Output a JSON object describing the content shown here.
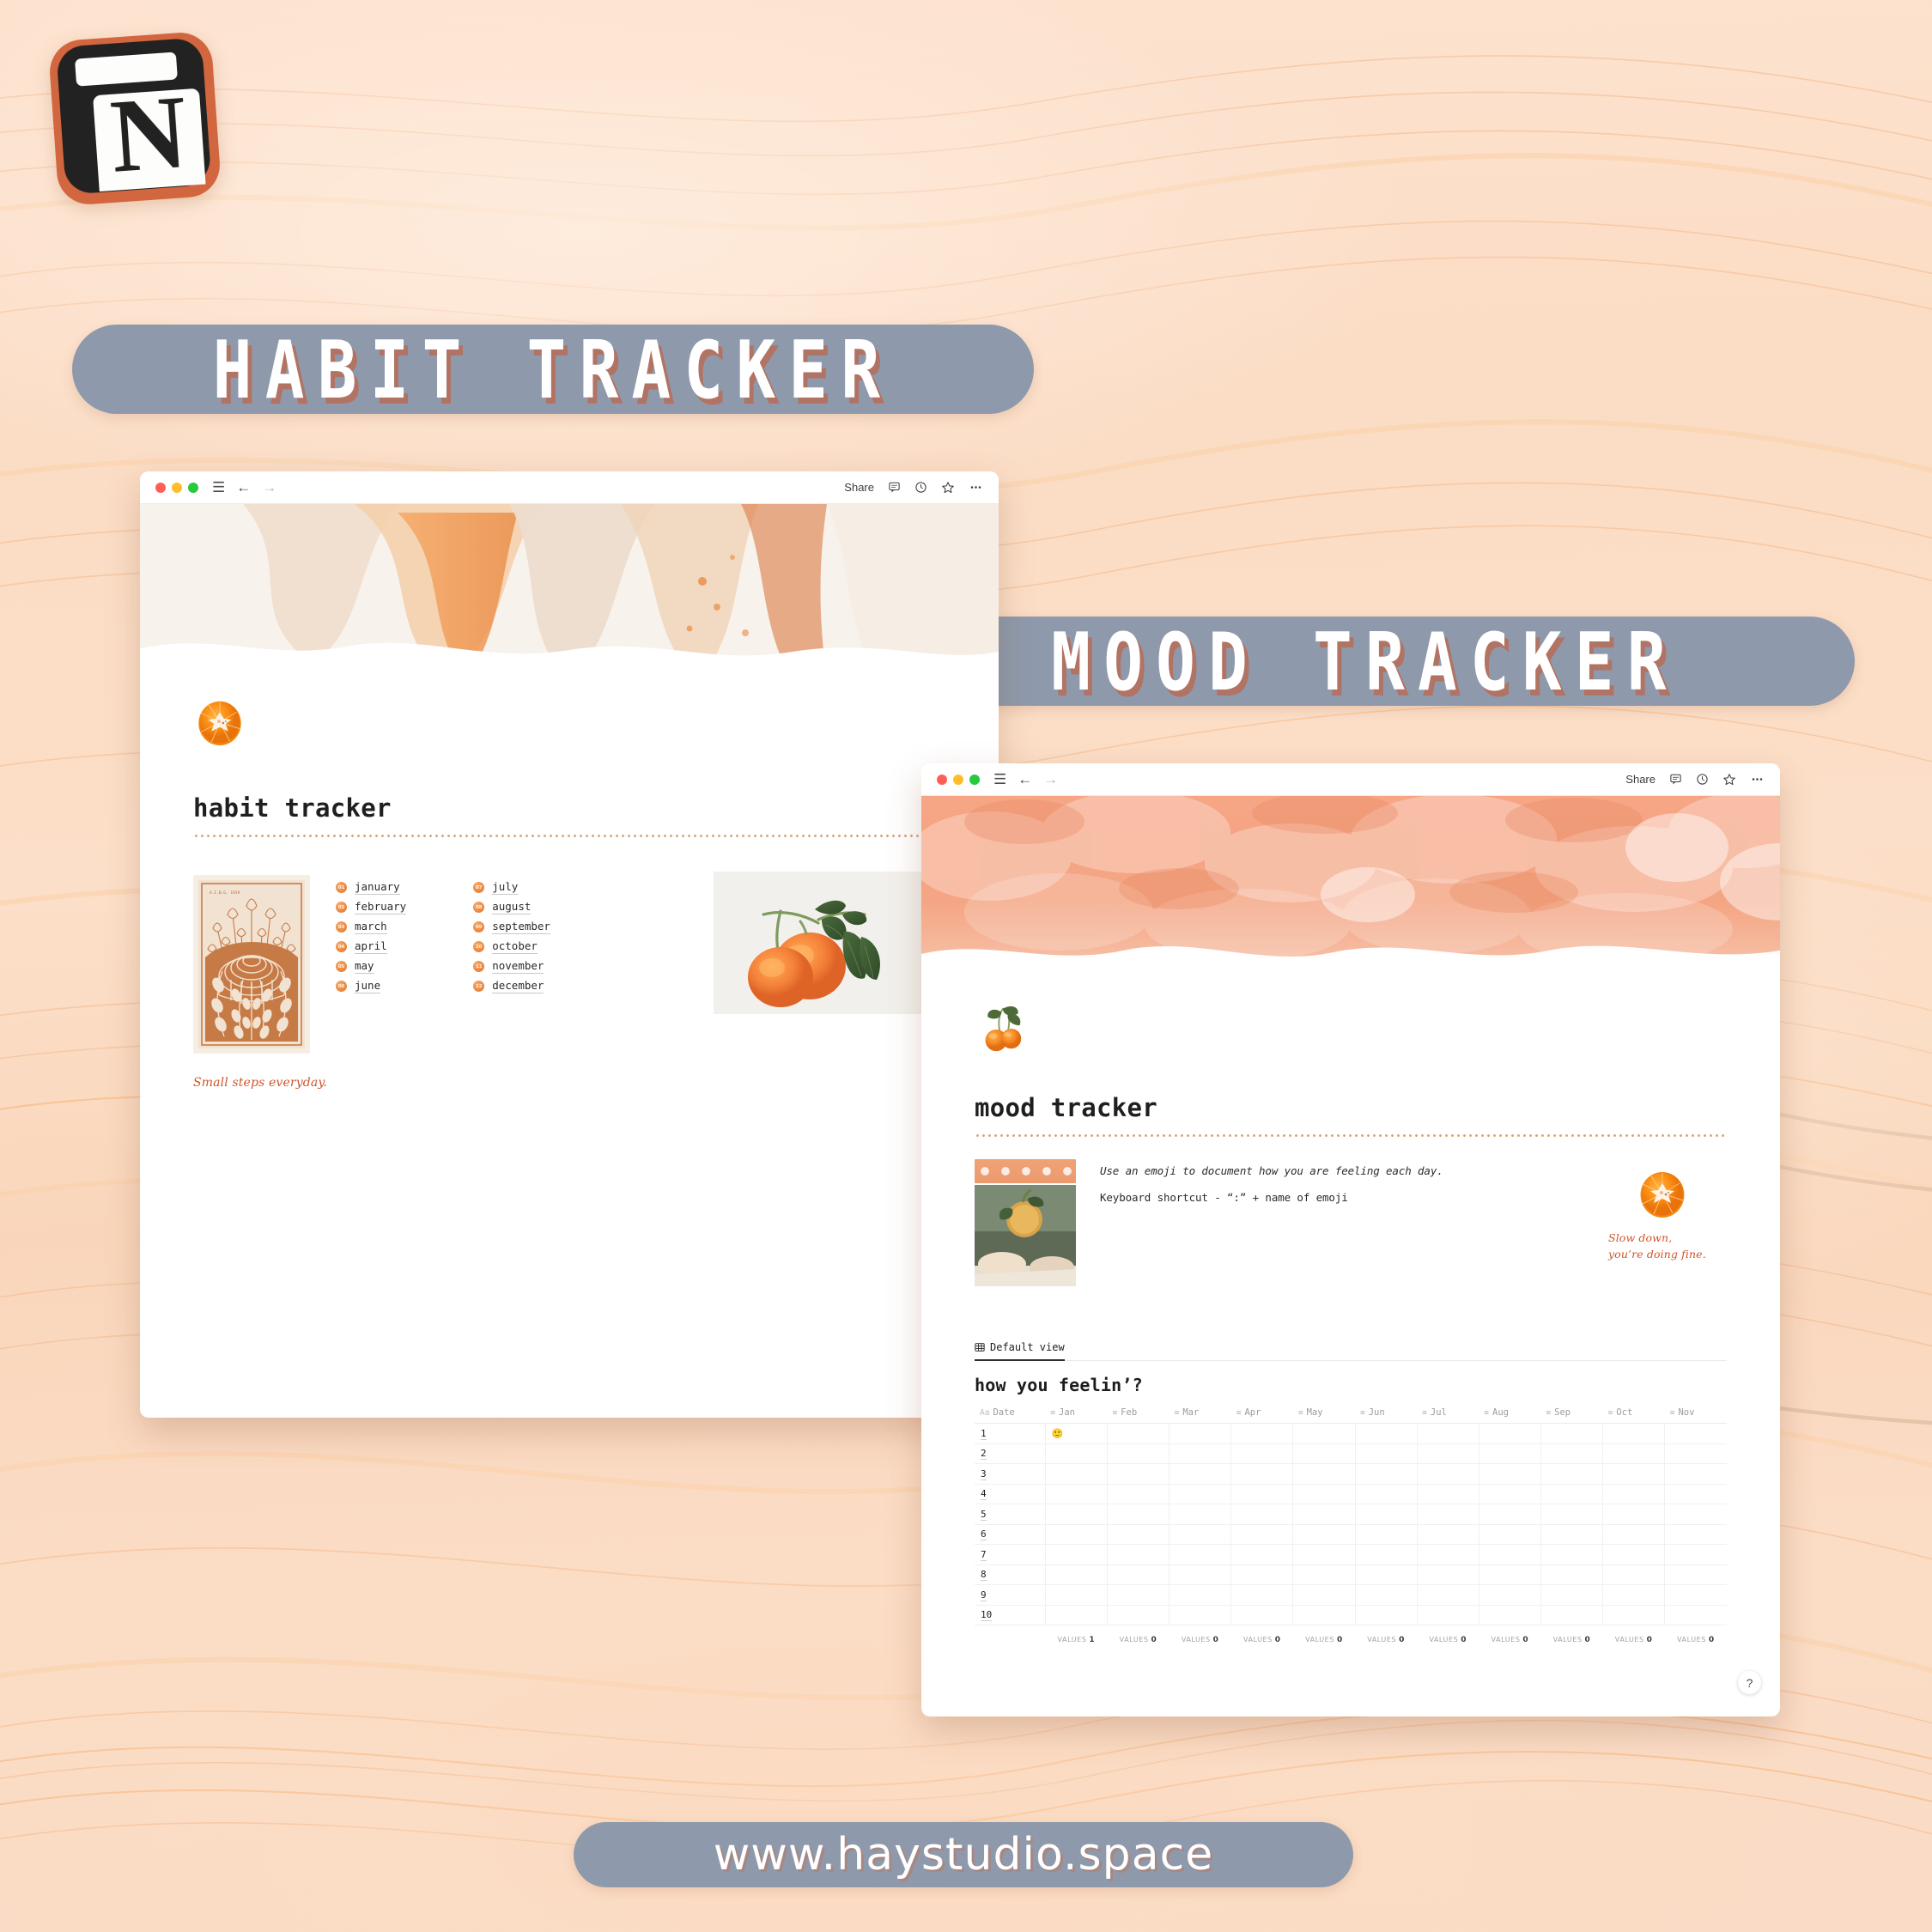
{
  "brand": {
    "logo_letter": "N",
    "logo_name": "notion-logo",
    "accent_orange": "#d1663f",
    "pill_gray": "#8e9aac",
    "quote_orange": "#cf542a"
  },
  "banners": {
    "habit": "HABIT  TRACKER",
    "mood": "MOOD  TRACKER",
    "url": "www.haystudio.space"
  },
  "window_chrome": {
    "share_label": "Share",
    "icons": [
      "comment-icon",
      "clock-icon",
      "star-icon",
      "more-icon"
    ],
    "nav": [
      "menu-icon",
      "back-arrow-icon",
      "forward-arrow-icon"
    ],
    "traffic_lights": [
      "close",
      "minimize",
      "maximize"
    ]
  },
  "habit_page": {
    "icon": "orange-slice-icon",
    "title": "habit tracker",
    "art_caption": "A.I.B.G. 1919",
    "months_left": [
      {
        "num": "01",
        "label": "january"
      },
      {
        "num": "02",
        "label": "february"
      },
      {
        "num": "03",
        "label": "march"
      },
      {
        "num": "04",
        "label": "april"
      },
      {
        "num": "05",
        "label": "may"
      },
      {
        "num": "06",
        "label": "june"
      }
    ],
    "months_right": [
      {
        "num": "07",
        "label": "july"
      },
      {
        "num": "08",
        "label": "august"
      },
      {
        "num": "09",
        "label": "september"
      },
      {
        "num": "10",
        "label": "october"
      },
      {
        "num": "11",
        "label": "november"
      },
      {
        "num": "12",
        "label": "december"
      }
    ],
    "quote": "Small steps everyday.",
    "photo": "oranges-on-branch-illustration"
  },
  "mood_page": {
    "icon": "two-oranges-icon",
    "title": "mood tracker",
    "note_1": "Use an emoji to document how you are feeling each day.",
    "note_2": "Keyboard shortcut - “:” + name of emoji",
    "quote_line_1": "Slow down,",
    "quote_line_2": "you’re doing fine.",
    "side_icon": "orange-slice-icon",
    "washi_photo": "hand-holding-orange-photo",
    "view_tab": "Default view",
    "view_tab_icon": "table-icon",
    "database_title": "how you feelin’?",
    "columns": [
      {
        "label": "Date",
        "icon": "Aa"
      },
      {
        "label": "Jan",
        "icon": "text-icon"
      },
      {
        "label": "Feb",
        "icon": "text-icon"
      },
      {
        "label": "Mar",
        "icon": "text-icon"
      },
      {
        "label": "Apr",
        "icon": "text-icon"
      },
      {
        "label": "May",
        "icon": "text-icon"
      },
      {
        "label": "Jun",
        "icon": "text-icon"
      },
      {
        "label": "Jul",
        "icon": "text-icon"
      },
      {
        "label": "Aug",
        "icon": "text-icon"
      },
      {
        "label": "Sep",
        "icon": "text-icon"
      },
      {
        "label": "Oct",
        "icon": "text-icon"
      },
      {
        "label": "Nov",
        "icon": "text-icon"
      }
    ],
    "rows": [
      {
        "date": "1",
        "cells": [
          "🙂",
          "",
          "",
          "",
          "",
          "",
          "",
          "",
          "",
          "",
          ""
        ]
      },
      {
        "date": "2",
        "cells": [
          "",
          "",
          "",
          "",
          "",
          "",
          "",
          "",
          "",
          "",
          ""
        ]
      },
      {
        "date": "3",
        "cells": [
          "",
          "",
          "",
          "",
          "",
          "",
          "",
          "",
          "",
          "",
          ""
        ]
      },
      {
        "date": "4",
        "cells": [
          "",
          "",
          "",
          "",
          "",
          "",
          "",
          "",
          "",
          "",
          ""
        ]
      },
      {
        "date": "5",
        "cells": [
          "",
          "",
          "",
          "",
          "",
          "",
          "",
          "",
          "",
          "",
          ""
        ]
      },
      {
        "date": "6",
        "cells": [
          "",
          "",
          "",
          "",
          "",
          "",
          "",
          "",
          "",
          "",
          ""
        ]
      },
      {
        "date": "7",
        "cells": [
          "",
          "",
          "",
          "",
          "",
          "",
          "",
          "",
          "",
          "",
          ""
        ]
      },
      {
        "date": "8",
        "cells": [
          "",
          "",
          "",
          "",
          "",
          "",
          "",
          "",
          "",
          "",
          ""
        ]
      },
      {
        "date": "9",
        "cells": [
          "",
          "",
          "",
          "",
          "",
          "",
          "",
          "",
          "",
          "",
          ""
        ]
      },
      {
        "date": "10",
        "cells": [
          "",
          "",
          "",
          "",
          "",
          "",
          "",
          "",
          "",
          "",
          ""
        ]
      }
    ],
    "footer_label": "VALUES",
    "footer_counts": [
      "1",
      "0",
      "0",
      "0",
      "0",
      "0",
      "0",
      "0",
      "0",
      "0",
      "0"
    ],
    "help_button": "?"
  }
}
